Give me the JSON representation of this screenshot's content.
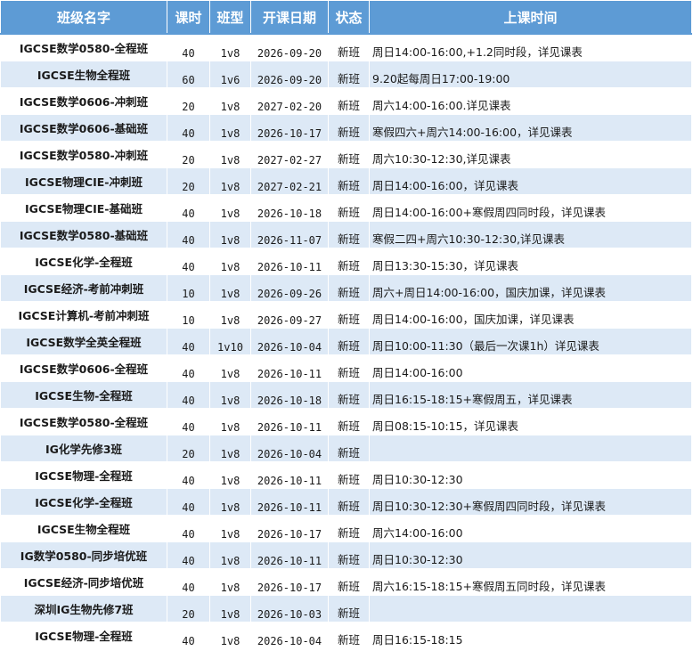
{
  "headers": {
    "name": "班级名字",
    "hours": "课时",
    "type": "班型",
    "start": "开课日期",
    "status": "状态",
    "time": "上课时间"
  },
  "rows": [
    {
      "name": "IGCSE数学0580-全程班",
      "hours": "40",
      "type": "1v8",
      "start": "2026-09-20",
      "status": "新班",
      "time": "周日14:00-16:00,+1.2同时段，详见课表"
    },
    {
      "name": "IGCSE生物全程班",
      "hours": "60",
      "type": "1v6",
      "start": "2026-09-20",
      "status": "新班",
      "time": "9.20起每周日17:00-19:00"
    },
    {
      "name": "IGCSE数学0606-冲刺班",
      "hours": "20",
      "type": "1v8",
      "start": "2027-02-20",
      "status": "新班",
      "time": "周六14:00-16:00.详见课表"
    },
    {
      "name": "IGCSE数学0606-基础班",
      "hours": "40",
      "type": "1v8",
      "start": "2026-10-17",
      "status": "新班",
      "time": "寒假四六+周六14:00-16:00，详见课表"
    },
    {
      "name": "IGCSE数学0580-冲刺班",
      "hours": "20",
      "type": "1v8",
      "start": "2027-02-27",
      "status": "新班",
      "time": "周六10:30-12:30,详见课表"
    },
    {
      "name": "IGCSE物理CIE-冲刺班",
      "hours": "20",
      "type": "1v8",
      "start": "2027-02-21",
      "status": "新班",
      "time": "周日14:00-16:00，详见课表"
    },
    {
      "name": "IGCSE物理CIE-基础班",
      "hours": "40",
      "type": "1v8",
      "start": "2026-10-18",
      "status": "新班",
      "time": "周日14:00-16:00+寒假周四同时段，详见课表"
    },
    {
      "name": "IGCSE数学0580-基础班",
      "hours": "40",
      "type": "1v8",
      "start": "2026-11-07",
      "status": "新班",
      "time": "寒假二四+周六10:30-12:30,详见课表"
    },
    {
      "name": "IGCSE化学-全程班",
      "hours": "40",
      "type": "1v8",
      "start": "2026-10-11",
      "status": "新班",
      "time": "周日13:30-15:30，详见课表"
    },
    {
      "name": "IGCSE经济-考前冲刺班",
      "hours": "10",
      "type": "1v8",
      "start": "2026-09-26",
      "status": "新班",
      "time": "周六+周日14:00-16:00，国庆加课，详见课表"
    },
    {
      "name": "IGCSE计算机-考前冲刺班",
      "hours": "10",
      "type": "1v8",
      "start": "2026-09-27",
      "status": "新班",
      "time": "周日14:00-16:00，国庆加课，详见课表"
    },
    {
      "name": "IGCSE数学全英全程班",
      "hours": "40",
      "type": "1v10",
      "start": "2026-10-04",
      "status": "新班",
      "time": "周日10:00-11:30（最后一次课1h）详见课表"
    },
    {
      "name": "IGCSE数学0606-全程班",
      "hours": "40",
      "type": "1v8",
      "start": "2026-10-11",
      "status": "新班",
      "time": "周日14:00-16:00"
    },
    {
      "name": "IGCSE生物-全程班",
      "hours": "40",
      "type": "1v8",
      "start": "2026-10-18",
      "status": "新班",
      "time": "周日16:15-18:15+寒假周五，详见课表"
    },
    {
      "name": "IGCSE数学0580-全程班",
      "hours": "40",
      "type": "1v8",
      "start": "2026-10-11",
      "status": "新班",
      "time": "周日08:15-10:15，详见课表"
    },
    {
      "name": "IG化学先修3班",
      "hours": "20",
      "type": "1v8",
      "start": "2026-10-04",
      "status": "新班",
      "time": ""
    },
    {
      "name": "IGCSE物理-全程班",
      "hours": "40",
      "type": "1v8",
      "start": "2026-10-11",
      "status": "新班",
      "time": "周日10:30-12:30"
    },
    {
      "name": "IGCSE化学-全程班",
      "hours": "40",
      "type": "1v8",
      "start": "2026-10-11",
      "status": "新班",
      "time": "周日10:30-12:30+寒假周四同时段，详见课表"
    },
    {
      "name": "IGCSE生物全程班",
      "hours": "40",
      "type": "1v8",
      "start": "2026-10-17",
      "status": "新班",
      "time": "周六14:00-16:00"
    },
    {
      "name": "IG数学0580-同步培优班",
      "hours": "40",
      "type": "1v8",
      "start": "2026-10-11",
      "status": "新班",
      "time": "周日10:30-12:30"
    },
    {
      "name": "IGCSE经济-同步培优班",
      "hours": "40",
      "type": "1v8",
      "start": "2026-10-17",
      "status": "新班",
      "time": "周六16:15-18:15+寒假周五同时段，详见课表"
    },
    {
      "name": "深圳IG生物先修7班",
      "hours": "20",
      "type": "1v8",
      "start": "2026-10-03",
      "status": "新班",
      "time": ""
    },
    {
      "name": "IGCSE物理-全程班",
      "hours": "40",
      "type": "1v8",
      "start": "2026-10-04",
      "status": "新班",
      "time": "周日16:15-18:15"
    }
  ]
}
